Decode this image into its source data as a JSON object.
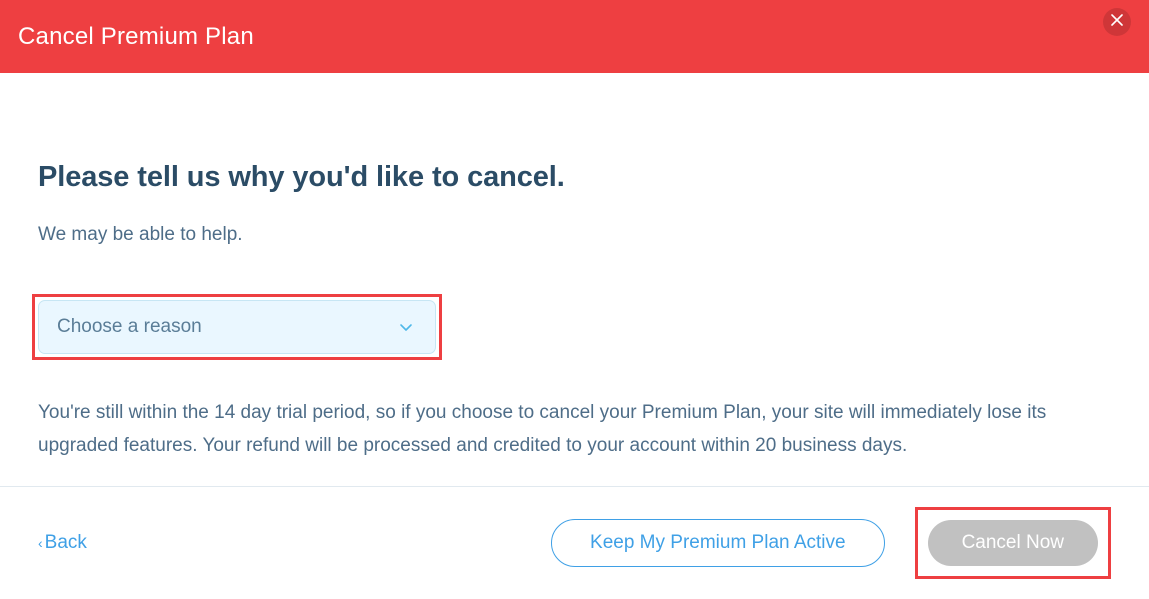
{
  "header": {
    "title": "Cancel Premium Plan"
  },
  "body": {
    "heading": "Please tell us why you'd like to cancel.",
    "subheading": "We may be able to help.",
    "reason_placeholder": "Choose a reason",
    "info_text": "You're still within the 14 day trial period, so if you choose to cancel your Premium Plan, your site will immediately lose its upgraded features. Your refund will be processed and credited to your account within 20 business days."
  },
  "footer": {
    "back_label": "Back",
    "keep_label": "Keep My Premium Plan Active",
    "cancel_label": "Cancel Now"
  }
}
